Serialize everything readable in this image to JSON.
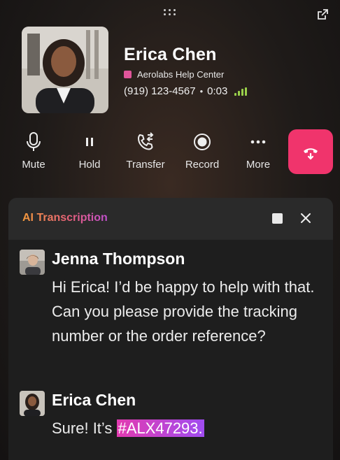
{
  "caller": {
    "name": "Erica Chen",
    "company": "Aerolabs Help Center",
    "phone": "(919) 123-4567",
    "separator": "•",
    "duration": "0:03"
  },
  "colors": {
    "end_call": "#f0346c",
    "company_dot": "#e0559a",
    "signal": "#9ad04a",
    "highlight_start": "#e23bb0",
    "highlight_end": "#a04cf0"
  },
  "controls": [
    {
      "label": "Mute",
      "icon": "microphone-icon"
    },
    {
      "label": "Hold",
      "icon": "pause-icon"
    },
    {
      "label": "Transfer",
      "icon": "phone-transfer-icon"
    },
    {
      "label": "Record",
      "icon": "record-icon"
    },
    {
      "label": "More",
      "icon": "more-icon"
    }
  ],
  "end_call": {
    "icon": "hang-up-icon"
  },
  "transcription": {
    "title": "AI Transcription",
    "messages": [
      {
        "speaker": "Jenna Thompson",
        "text": "Hi Erica! I’d be happy to help with that. Can you please provide the tracking number or the order reference?"
      },
      {
        "speaker": "Erica Chen",
        "text_prefix": "Sure! It’s ",
        "highlight": "#ALX47293."
      }
    ]
  }
}
